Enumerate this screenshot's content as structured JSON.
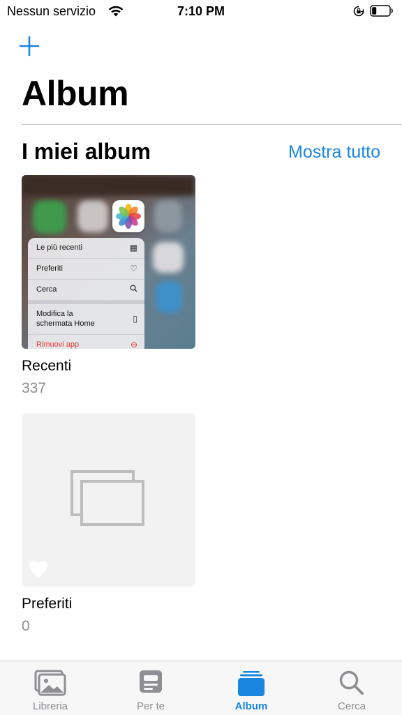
{
  "status_bar": {
    "carrier": "Nessun servizio",
    "time": "7:10 PM"
  },
  "nav": {
    "add_icon": "plus-icon",
    "title": "Album"
  },
  "section": {
    "title": "I miei album",
    "show_all": "Mostra tutto"
  },
  "albums": [
    {
      "name": "Recenti",
      "count": "337",
      "thumbnail_menu": [
        {
          "label": "Le più recenti",
          "icon": "recent-icon"
        },
        {
          "label": "Preferiti",
          "icon": "heart-icon"
        },
        {
          "label": "Cerca",
          "icon": "search-icon"
        },
        {
          "label": "Modifica la schermata Home",
          "icon": "phone-icon"
        },
        {
          "label": "Rimuovi app",
          "icon": "minus-circle-icon"
        }
      ]
    },
    {
      "name": "Preferiti",
      "count": "0"
    }
  ],
  "tabs": [
    {
      "label": "Libreria",
      "icon": "photos-library-icon",
      "active": false
    },
    {
      "label": "Per te",
      "icon": "for-you-icon",
      "active": false
    },
    {
      "label": "Album",
      "icon": "albums-icon",
      "active": true
    },
    {
      "label": "Cerca",
      "icon": "search-icon",
      "active": false
    }
  ],
  "colors": {
    "accent": "#1a86e0",
    "secondary_text": "#8e8e93",
    "destructive": "#e5392f"
  }
}
